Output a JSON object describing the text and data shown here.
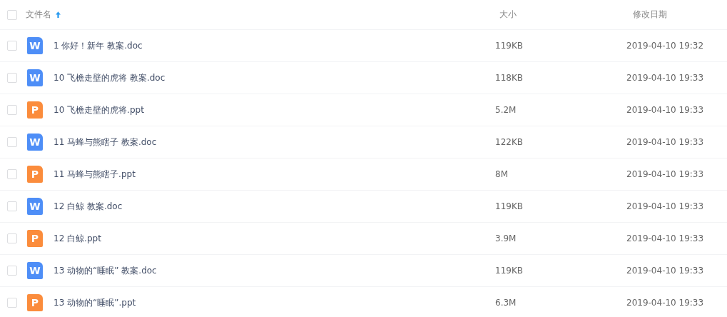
{
  "header": {
    "checked": false,
    "columns": [
      {
        "label": "文件名",
        "sorted": true
      },
      {
        "label": "大小"
      },
      {
        "label": "修改日期"
      }
    ]
  },
  "rows": [
    {
      "kind": "word",
      "icon_letter": "W",
      "name": "1 你好！新年 教案.doc",
      "size": "119KB",
      "modified": "2019-04-10 19:32",
      "checked": false
    },
    {
      "kind": "word",
      "icon_letter": "W",
      "name": "10 飞檐走壁的虎将 教案.doc",
      "size": "118KB",
      "modified": "2019-04-10 19:33",
      "checked": false
    },
    {
      "kind": "ppt",
      "icon_letter": "P",
      "name": "10 飞檐走壁的虎将.ppt",
      "size": "5.2M",
      "modified": "2019-04-10 19:33",
      "checked": false
    },
    {
      "kind": "word",
      "icon_letter": "W",
      "name": "11 马蜂与熊瞎子 教案.doc",
      "size": "122KB",
      "modified": "2019-04-10 19:33",
      "checked": false
    },
    {
      "kind": "ppt",
      "icon_letter": "P",
      "name": "11 马蜂与熊瞎子.ppt",
      "size": "8M",
      "modified": "2019-04-10 19:33",
      "checked": false
    },
    {
      "kind": "word",
      "icon_letter": "W",
      "name": "12 白鲸 教案.doc",
      "size": "119KB",
      "modified": "2019-04-10 19:33",
      "checked": false
    },
    {
      "kind": "ppt",
      "icon_letter": "P",
      "name": "12 白鲸.ppt",
      "size": "3.9M",
      "modified": "2019-04-10 19:33",
      "checked": false
    },
    {
      "kind": "word",
      "icon_letter": "W",
      "name": "13 动物的“睡眠” 教案.doc",
      "size": "119KB",
      "modified": "2019-04-10 19:33",
      "checked": false
    },
    {
      "kind": "ppt",
      "icon_letter": "P",
      "name": "13 动物的“睡眠”.ppt",
      "size": "6.3M",
      "modified": "2019-04-10 19:33",
      "checked": false
    }
  ]
}
